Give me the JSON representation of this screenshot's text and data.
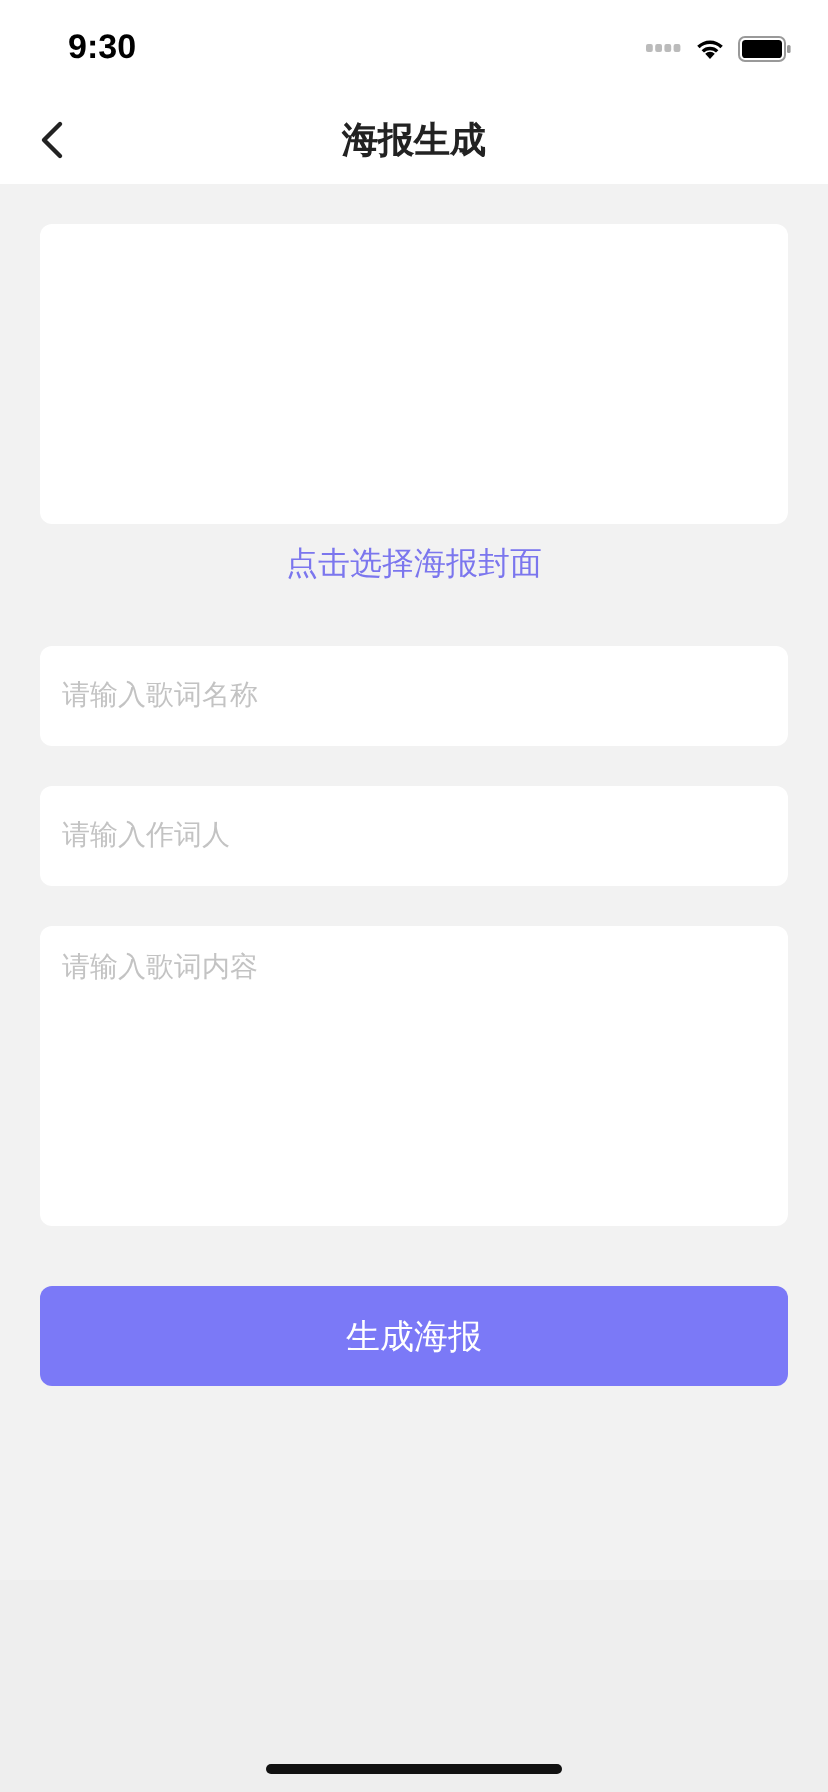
{
  "status_bar": {
    "time": "9:30"
  },
  "nav": {
    "title": "海报生成"
  },
  "cover": {
    "link": "点击选择海报封面"
  },
  "fields": [
    {
      "kind": "input",
      "placeholder": "请输入歌词名称"
    },
    {
      "kind": "input",
      "placeholder": "请输入作词人"
    },
    {
      "kind": "textarea",
      "placeholder": "请输入歌词内容"
    }
  ],
  "submit": {
    "label": "生成海报"
  }
}
